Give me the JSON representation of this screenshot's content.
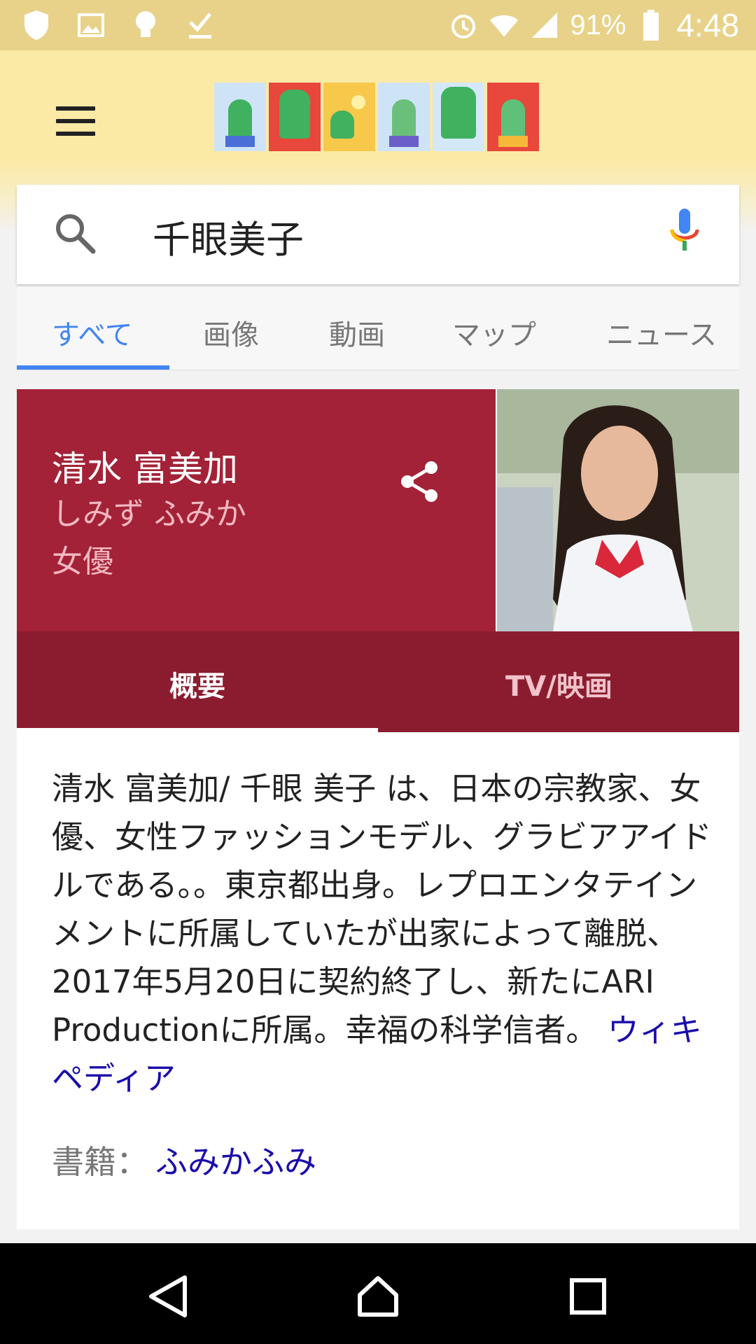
{
  "status_bar": {
    "battery_percent": "91%",
    "time": "4:48",
    "left_icons": [
      "shield-icon",
      "gallery-icon",
      "lightbulb-icon",
      "download-done-icon"
    ],
    "right_icons": [
      "alarm-icon",
      "wifi-icon",
      "signal-icon",
      "battery-icon"
    ]
  },
  "header": {
    "menu_icon": "hamburger-menu-icon",
    "doodle": "google-doodle-cactus"
  },
  "search": {
    "query": "千眼美子",
    "search_icon": "search-icon",
    "mic_icon": "mic-icon"
  },
  "tabs": [
    {
      "label": "すべて",
      "active": true
    },
    {
      "label": "画像",
      "active": false
    },
    {
      "label": "動画",
      "active": false
    },
    {
      "label": "マップ",
      "active": false
    },
    {
      "label": "ニュース",
      "active": false
    }
  ],
  "knowledge_panel": {
    "name": "清水 富美加",
    "kana": "しみず ふみか",
    "role": "女優",
    "header_color": "#a32237",
    "sub_tabs": [
      {
        "label": "概要",
        "active": true
      },
      {
        "label": "TV/映画",
        "active": false
      }
    ],
    "description": "清水 富美加/ 千眼 美子 は、日本の宗教家、女優、女性ファッションモデル、グラビアアイドルである。。東京都出身。レプロエンタテインメントに所属していたが出家によって離脱、2017年5月20日に契約終了し、新たにARI Productionに所属。幸福の科学信者。",
    "source_link": "ウィキペディア",
    "book_label": "書籍：",
    "book_link": "ふみかふみ"
  },
  "nav_bar": {
    "back_icon": "back-triangle-icon",
    "home_icon": "home-icon",
    "recents_icon": "recents-square-icon"
  }
}
